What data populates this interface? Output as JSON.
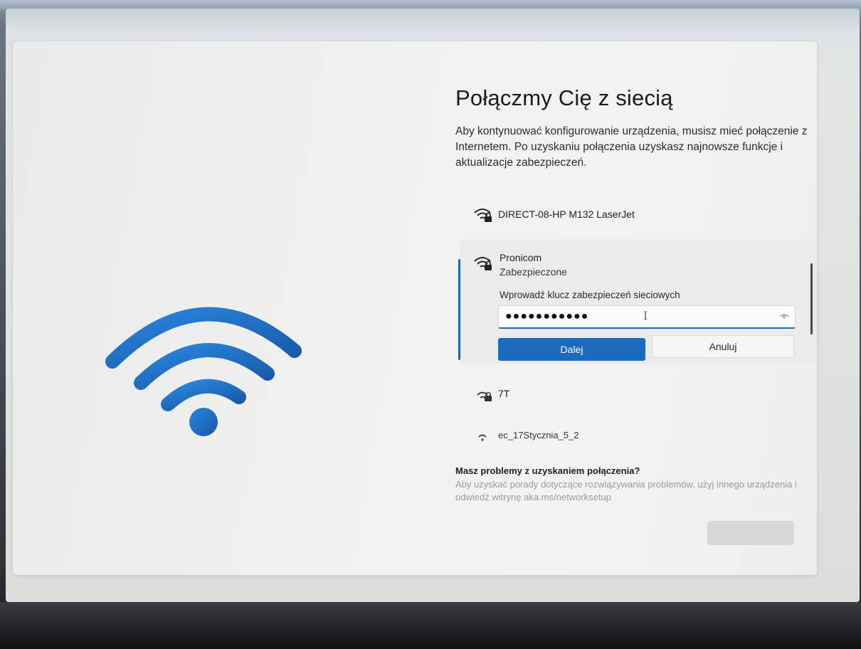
{
  "page": {
    "title": "Połączmy Cię z siecią",
    "description": "Aby kontynuować konfigurowanie urządzenia, musisz mieć połączenie z Internetem. Po uzyskaniu połączenia uzyskasz najnowsze funkcje i aktualizacje zabezpieczeń."
  },
  "networks": [
    {
      "name": "DIRECT-08-HP M132 LaserJet",
      "icon": "wifi-lock-icon"
    },
    {
      "name": "Pronicom",
      "status": "Zabezpieczone",
      "icon": "wifi-lock-icon"
    },
    {
      "name": "7T",
      "icon": "wifi-lock-icon"
    },
    {
      "name": "ec_17Stycznia_5_2",
      "icon": "wifi-weak-icon"
    }
  ],
  "password": {
    "label": "Wprowadź klucz zabezpieczeń sieciowych",
    "masked_value": "●●●●●●●●●●●"
  },
  "buttons": {
    "next": "Dalej",
    "cancel": "Anuluj"
  },
  "help": {
    "title": "Masz problemy z uzyskaniem połączenia?",
    "text": "Aby uzyskać porady dotyczące rozwiązywania problemów, użyj innego urządzenia i odwiedź witrynę aka.ms/networksetup"
  },
  "colors": {
    "accent": "#1a6bbd",
    "wifi_art": "#1f6fc2"
  }
}
